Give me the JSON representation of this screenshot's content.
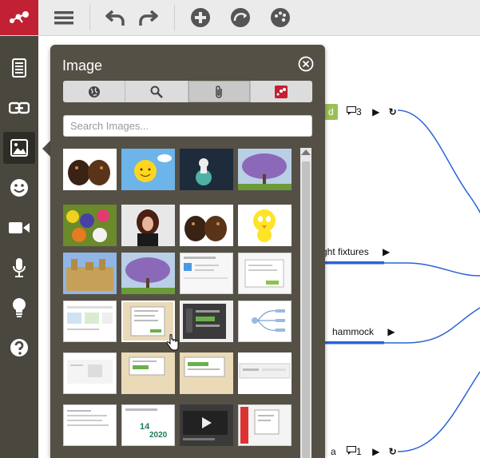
{
  "toolbar": {
    "items": [
      "menu-icon",
      "undo-icon",
      "redo-icon",
      "add-icon",
      "connect-icon",
      "palette-icon"
    ]
  },
  "sidebar": {
    "items": [
      "outline-icon",
      "link-icon",
      "image-icon",
      "emoji-icon",
      "video-icon",
      "microphone-icon",
      "lightbulb-icon",
      "help-icon"
    ],
    "active": "image-icon"
  },
  "canvas": {
    "nodes": [
      {
        "label": "d",
        "comments": "3"
      },
      {
        "label": "ght fixtures"
      },
      {
        "label": "hammock"
      },
      {
        "label": "a",
        "comments": "1"
      }
    ]
  },
  "panel": {
    "title": "Image",
    "tabs": [
      "globe-icon",
      "search-icon",
      "attachment-icon",
      "mindmeister-icon"
    ],
    "selected_tab": "attachment-icon",
    "search_placeholder": "Search Images..."
  },
  "images": [
    "dachshunds",
    "smiling-sun",
    "astronaut-cartoon",
    "lilac-tree",
    "flower-bouquet",
    "woman-portrait",
    "dachshunds",
    "tweety-bird",
    "castle",
    "lilac-tree",
    "screenshot",
    "screenshot",
    "screenshot",
    "screenshot",
    "dark-screenshot",
    "diagram-screenshot",
    "screenshot",
    "screenshot",
    "screenshot",
    "screenshot",
    "screenshot",
    "calendar-14-2020",
    "video-screenshot",
    "screenshot"
  ],
  "colors": {
    "brand": "#c22033",
    "panel": "#555046",
    "sidebar": "#4a473f",
    "connector": "#2b63d6"
  }
}
